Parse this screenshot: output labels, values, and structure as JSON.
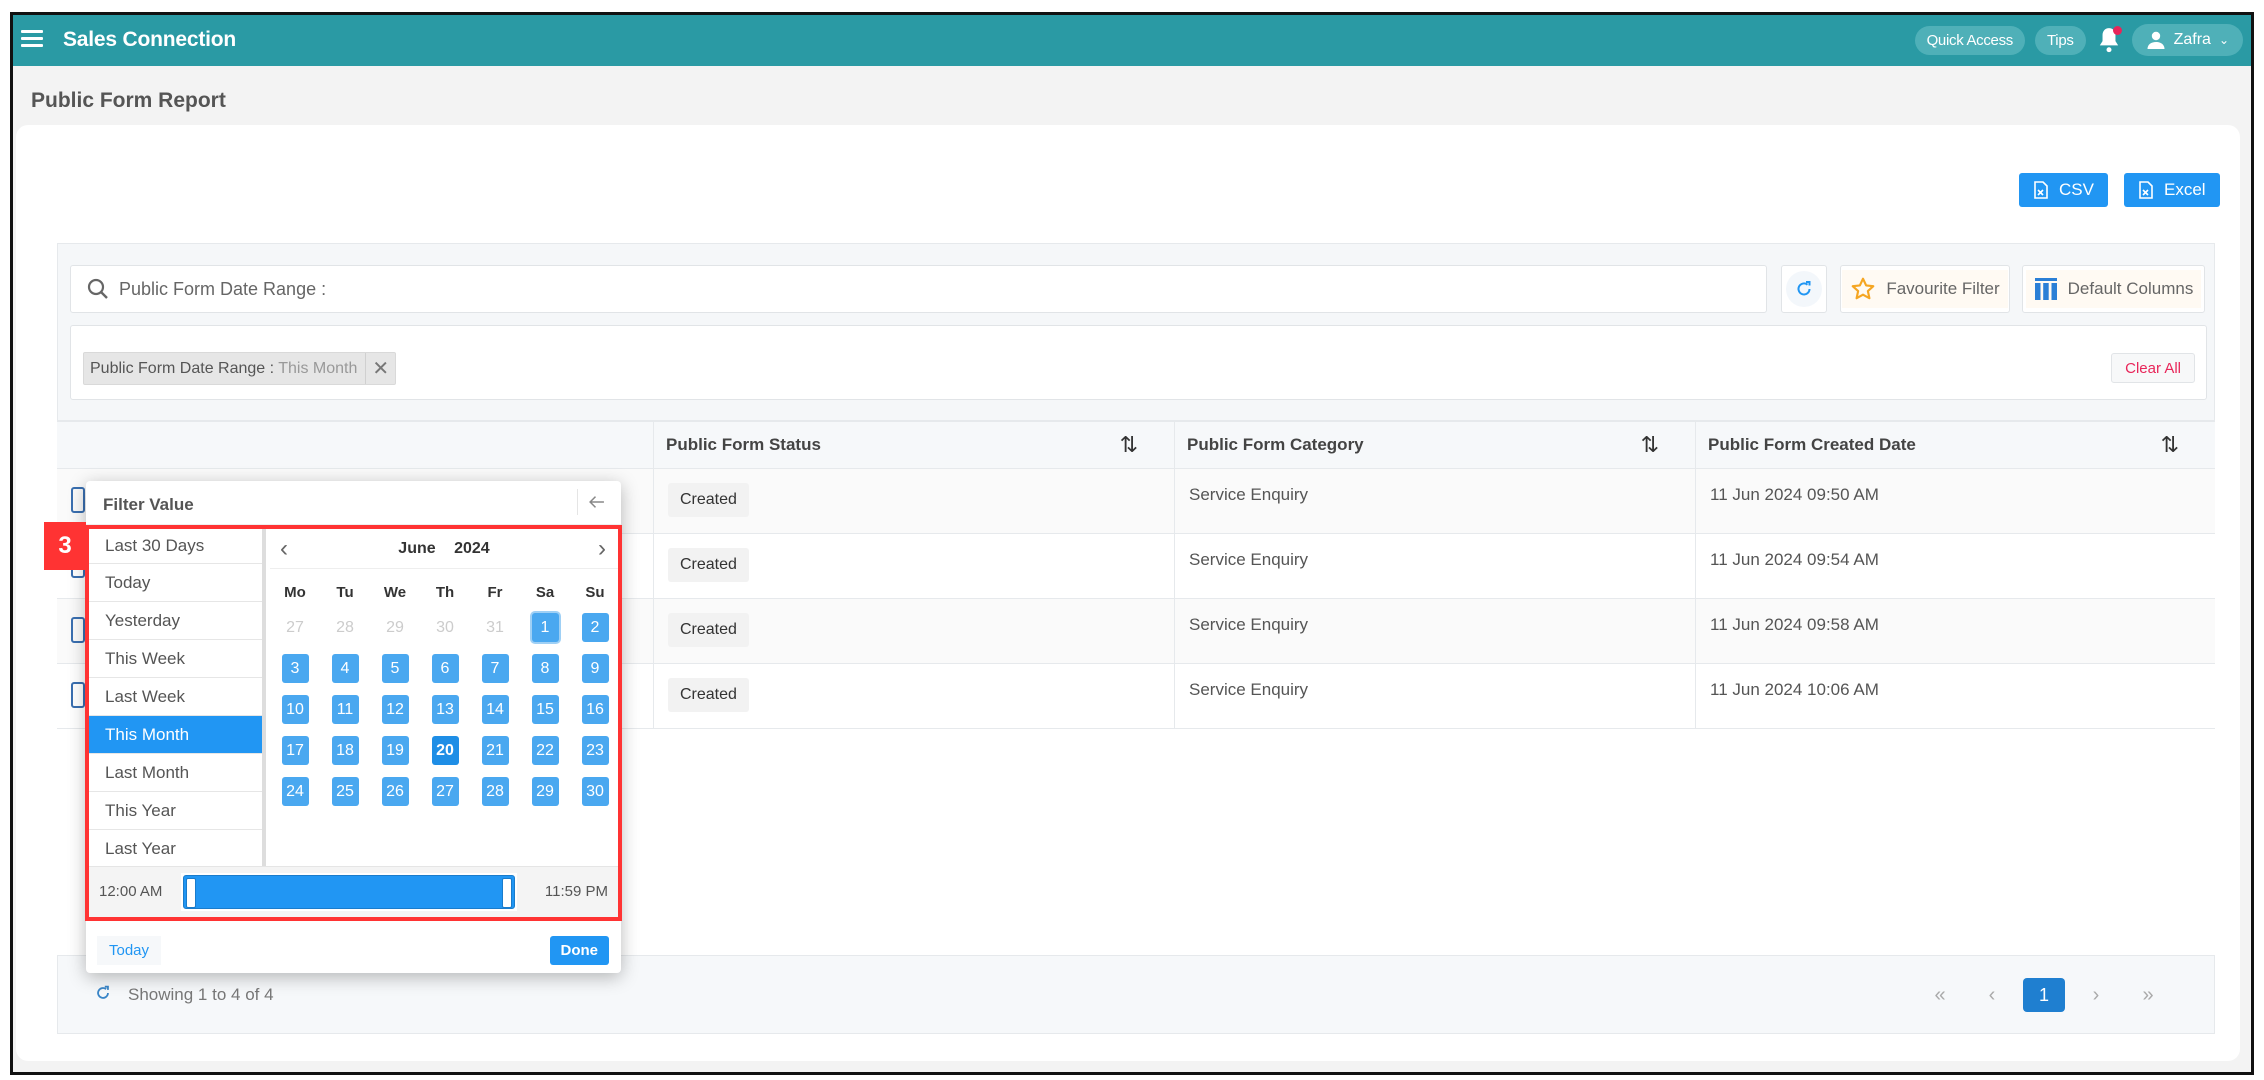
{
  "app": {
    "title": "Sales Connection",
    "quick_access_label": "Quick Access",
    "tips_label": "Tips",
    "user_name": "Zafra",
    "notification_dot": true
  },
  "page": {
    "title": "Public Form Report"
  },
  "export": {
    "csv_label": "CSV",
    "excel_label": "Excel"
  },
  "filter": {
    "search_placeholder": "Public Form Date Range :",
    "favourite_label": "Favourite Filter",
    "default_columns_label": "Default Columns",
    "chip_label": "Public Form Date Range :",
    "chip_value": "This Month",
    "clear_all_label": "Clear All"
  },
  "table": {
    "columns": [
      {
        "label": ""
      },
      {
        "label": "Public Form Status"
      },
      {
        "label": "Public Form Category"
      },
      {
        "label": "Public Form Created Date"
      }
    ],
    "rows": [
      {
        "status": "Created",
        "category": "Service Enquiry",
        "created": "11 Jun 2024 09:50 AM"
      },
      {
        "status": "Created",
        "category": "Service Enquiry",
        "created": "11 Jun 2024 09:54 AM"
      },
      {
        "status": "Created",
        "category": "Service Enquiry",
        "created": "11 Jun 2024 09:58 AM"
      },
      {
        "status": "Created",
        "category": "Service Enquiry",
        "created": "11 Jun 2024 10:06 AM"
      }
    ]
  },
  "footer": {
    "showing_text": "Showing 1 to 4 of 4",
    "pager": {
      "first": "«",
      "prev": "‹",
      "current": "1",
      "next": "›",
      "last": "»"
    }
  },
  "popup": {
    "title": "Filter Value",
    "step_number": "3",
    "presets": [
      {
        "label": "Last 30 Days",
        "active": false
      },
      {
        "label": "Today",
        "active": false
      },
      {
        "label": "Yesterday",
        "active": false
      },
      {
        "label": "This Week",
        "active": false
      },
      {
        "label": "Last Week",
        "active": false
      },
      {
        "label": "This Month",
        "active": true
      },
      {
        "label": "Last Month",
        "active": false
      },
      {
        "label": "This Year",
        "active": false
      },
      {
        "label": "Last Year",
        "active": false
      }
    ],
    "calendar": {
      "month": "June",
      "year": "2024",
      "weekdays": [
        "Mo",
        "Tu",
        "We",
        "Th",
        "Fr",
        "Sa",
        "Su"
      ],
      "leading_days": [
        "27",
        "28",
        "29",
        "30",
        "31"
      ],
      "days_in_month": 30,
      "range_start": 1,
      "range_end": 30,
      "today": 20
    },
    "time": {
      "from": "12:00 AM",
      "to": "11:59 PM"
    },
    "today_label": "Today",
    "done_label": "Done"
  },
  "colors": {
    "topbar": "#2a9aa4",
    "primary": "#2196f3",
    "highlight": "#ff3333",
    "danger_text": "#e8265a"
  }
}
